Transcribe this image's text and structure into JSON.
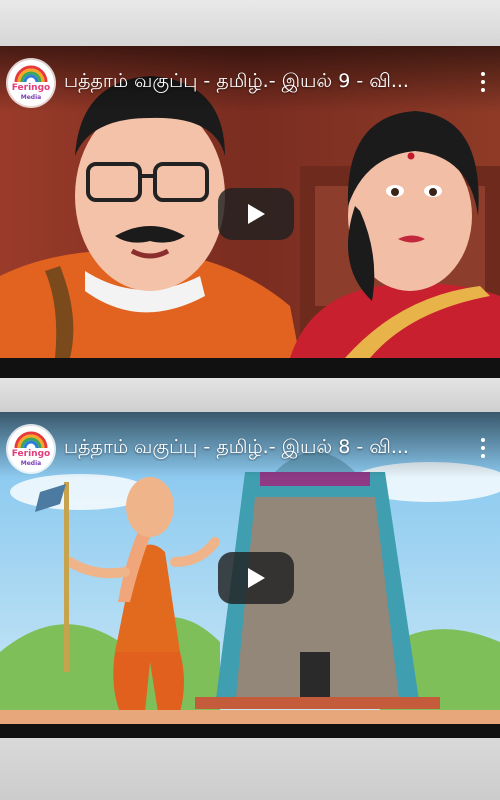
{
  "videos": [
    {
      "title": "பத்தாம் வகுப்பு - தமிழ்.- இயல் 9 - வி...",
      "channel_logo_text": "Feringo",
      "channel_logo_sub": "Media",
      "play_icon": "play-icon",
      "menu_icon": "more-vert-icon"
    },
    {
      "title": "பத்தாம் வகுப்பு - தமிழ்.- இயல் 8 - வி...",
      "channel_logo_text": "Feringo",
      "channel_logo_sub": "Media",
      "play_icon": "play-icon",
      "menu_icon": "more-vert-icon"
    }
  ],
  "colors": {
    "play_button_bg": "#212121",
    "title_text": "#ffffff",
    "logo_pink": "#e23c7b"
  }
}
